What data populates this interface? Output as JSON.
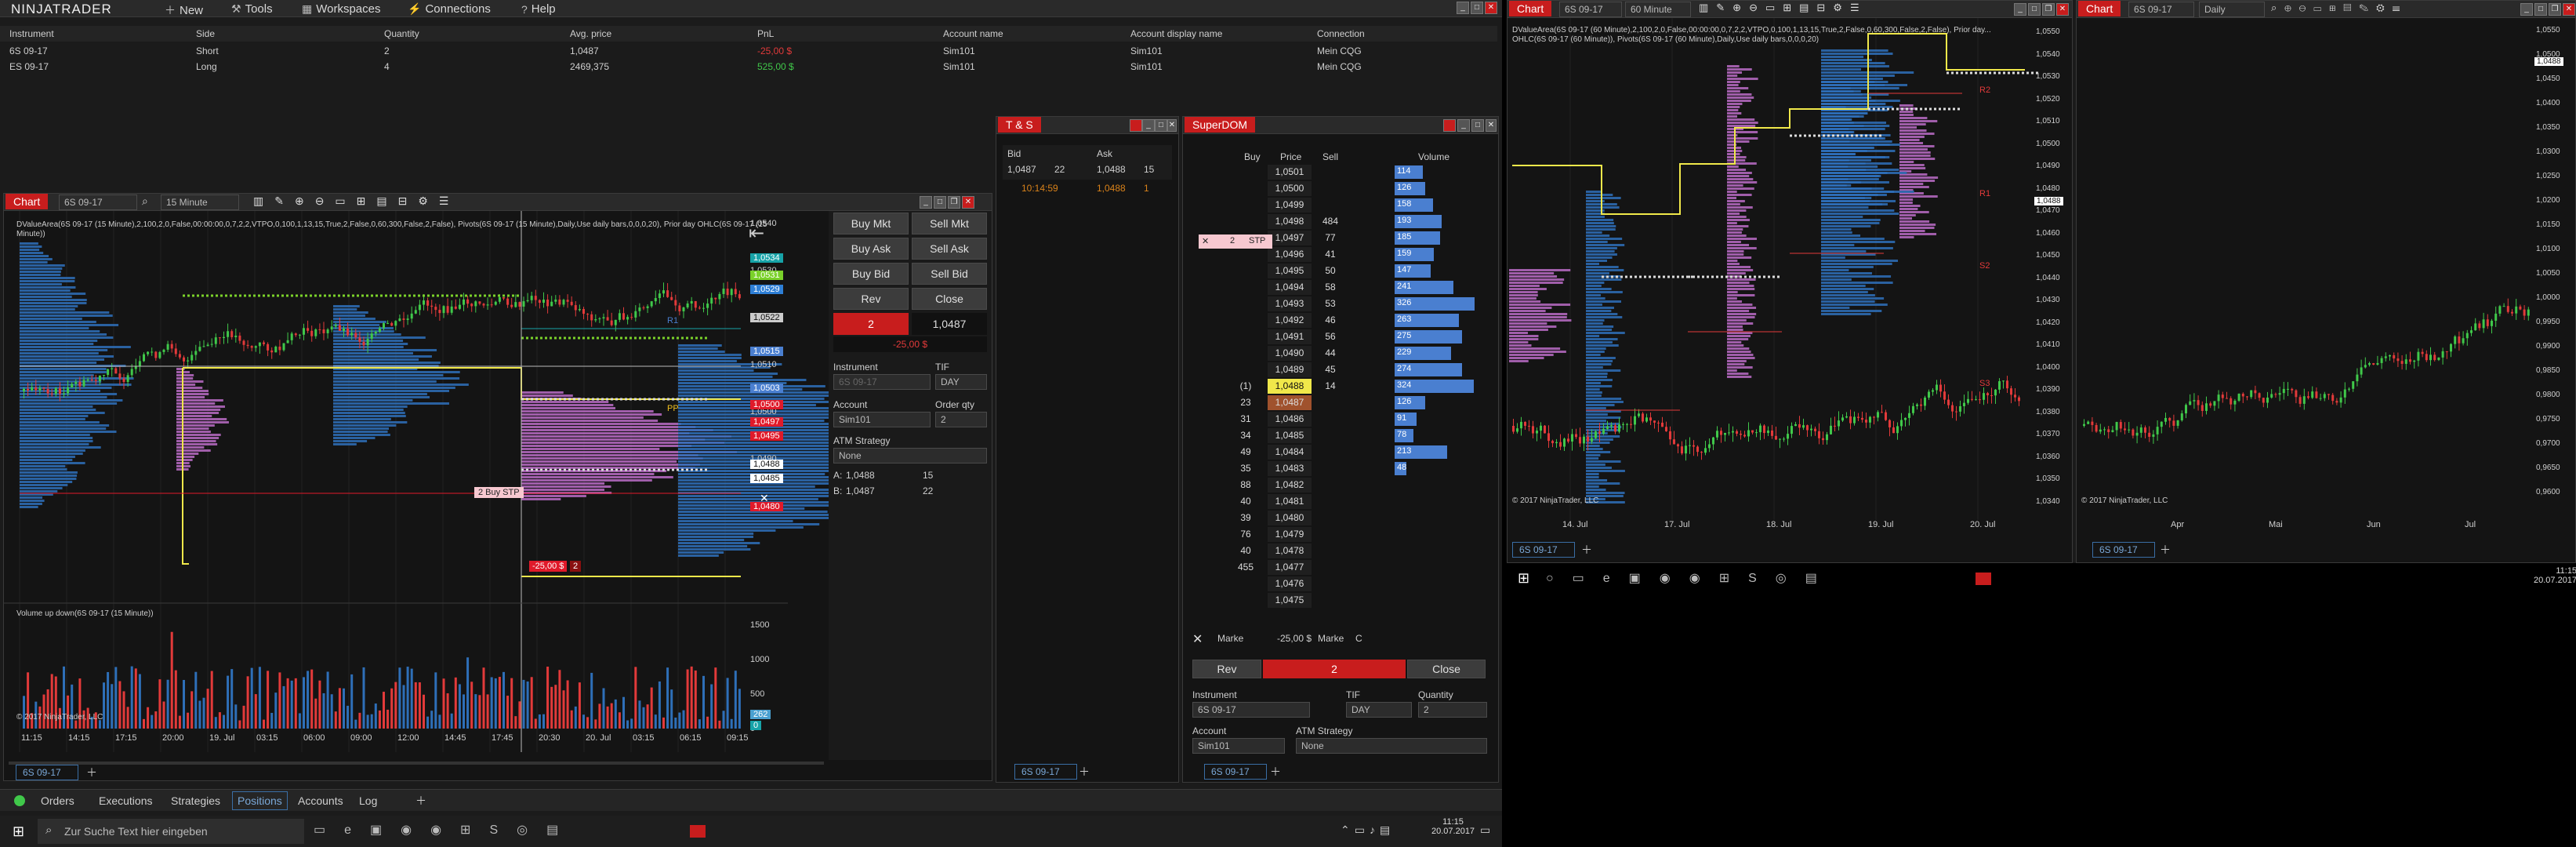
{
  "app": {
    "logo": "NINJATRADER"
  },
  "menu": [
    {
      "label": "New",
      "icon": "plus-icon"
    },
    {
      "label": "Tools",
      "icon": "wrench-icon"
    },
    {
      "label": "Workspaces",
      "icon": "grid-icon"
    },
    {
      "label": "Connections",
      "icon": "plug-icon"
    },
    {
      "label": "Help",
      "icon": "help-icon"
    }
  ],
  "positions": {
    "headers": [
      "Instrument",
      "Side",
      "Quantity",
      "Avg. price",
      "PnL",
      "Account name",
      "Account display name",
      "Connection"
    ],
    "rows": [
      {
        "instrument": "6S 09-17",
        "side": "Short",
        "qty": "2",
        "avg": "1,0487",
        "pnl": "-25,00 $",
        "pnl_color": "#e23a3a",
        "account": "Sim101",
        "display": "Sim101",
        "conn": "Mein CQG"
      },
      {
        "instrument": "ES 09-17",
        "side": "Long",
        "qty": "4",
        "avg": "2469,375",
        "pnl": "525,00 $",
        "pnl_color": "#40c84a",
        "account": "Sim101",
        "display": "Sim101",
        "conn": "Mein CQG"
      }
    ]
  },
  "chart1": {
    "tab": "Chart",
    "instrument": "6S 09-17",
    "interval": "15 Minute",
    "info": "DValueArea(6S 09-17 (15 Minute),2,100,2,0,False,00:00:00,0,7,2,2,VTPO,0,100,1,13,15,True,2,False,0,60,300,False,2,False), Pivots(6S 09-17 (15 Minute),Daily,Use daily bars,0,0,0,20), Prior day OHLC(6S 09-17 (15 Minute))",
    "y_ticks": [
      "1,0540",
      "1,0530",
      "1,0520",
      "1,0510",
      "1,0500",
      "1,0490",
      "1,0480"
    ],
    "price_tags": [
      {
        "v": "1,0534",
        "c": "#17a3a8"
      },
      {
        "v": "1,0531",
        "c": "#7ad12a"
      },
      {
        "v": "1,0529",
        "c": "#2e7fd6"
      },
      {
        "v": "1,0522",
        "c": "#cccccc"
      },
      {
        "v": "1,0515",
        "c": "#4a7fd0"
      },
      {
        "v": "1,0503",
        "c": "#4a7fd0"
      },
      {
        "v": "1,0500",
        "c": "#e01a2a"
      },
      {
        "v": "1,0497",
        "c": "#e01a2a"
      },
      {
        "v": "1,0495",
        "c": "#e01a2a"
      },
      {
        "v": "1,0488",
        "c": "#ffffff"
      },
      {
        "v": "1,0485",
        "c": "#ffffff"
      },
      {
        "v": "1,0480",
        "c": "#e01a2a"
      }
    ],
    "x_ticks": [
      "11:15",
      "14:15",
      "17:15",
      "20:00",
      "19. Jul",
      "03:15",
      "06:00",
      "09:00",
      "12:00",
      "14:45",
      "17:45",
      "20:30",
      "20. Jul",
      "03:15",
      "06:15",
      "09:15"
    ],
    "order_label": "2 Buy STP",
    "pnl_label": "-25,00 $",
    "pnl_qty": "2",
    "r1": "R1",
    "pp": "PP",
    "vol_label": "Volume up down(6S 09-17 (15 Minute))",
    "vol_ticks": [
      "1500",
      "1000",
      "500",
      "0"
    ],
    "vol_tags": [
      {
        "v": "262",
        "c": "#4aa0d0"
      },
      {
        "v": "0",
        "c": "#17a3a8"
      }
    ],
    "copyright": "© 2017 NinjaTrader, LLC",
    "footer_tab": "6S 09-17"
  },
  "chart_trader": {
    "buy_mkt": "Buy Mkt",
    "sell_mkt": "Sell Mkt",
    "buy_ask": "Buy Ask",
    "sell_ask": "Sell Ask",
    "buy_bid": "Buy Bid",
    "sell_bid": "Sell Bid",
    "rev": "Rev",
    "close": "Close",
    "pos_qty": "2",
    "pos_price": "1,0487",
    "pos_pnl": "-25,00 $",
    "instrument_lbl": "Instrument",
    "tif_lbl": "TIF",
    "instrument": "6S 09-17",
    "tif": "DAY",
    "account_lbl": "Account",
    "qty_lbl": "Order qty",
    "account": "Sim101",
    "qty": "2",
    "atm_lbl": "ATM Strategy",
    "atm": "None",
    "a_lbl": "A:",
    "a_price": "1,0488",
    "a_size": "15",
    "b_lbl": "B:",
    "b_price": "1,0487",
    "b_size": "22"
  },
  "ts": {
    "title": "T & S",
    "bid_lbl": "Bid",
    "ask_lbl": "Ask",
    "bid": "1,0487",
    "bid_size": "22",
    "ask": "1,0488",
    "ask_size": "15",
    "time": "10:14:59",
    "trade_price": "1,0488",
    "trade_size": "1",
    "footer_tab": "6S 09-17"
  },
  "dom": {
    "title": "SuperDOM",
    "headers": [
      "Buy",
      "Price",
      "Sell",
      "Volume"
    ],
    "order": {
      "qty": "2",
      "type": "STP"
    },
    "rows": [
      {
        "buy": "",
        "price": "1,0501",
        "sell": "",
        "vol": 0
      },
      {
        "buy": "",
        "price": "1,0500",
        "sell": "",
        "vol": 0
      },
      {
        "buy": "",
        "price": "1,0499",
        "sell": "",
        "vol": 0
      },
      {
        "buy": "",
        "price": "1,0498",
        "sell": "484",
        "vol": 0
      },
      {
        "buy": "",
        "price": "1,0497",
        "sell": "77",
        "vol": 0
      },
      {
        "buy": "",
        "price": "1,0496",
        "sell": "41",
        "vol": 0
      },
      {
        "buy": "",
        "price": "1,0495",
        "sell": "50",
        "vol": 0
      },
      {
        "buy": "",
        "price": "1,0494",
        "sell": "58",
        "vol": 0
      },
      {
        "buy": "",
        "price": "1,0493",
        "sell": "53",
        "vol": 0
      },
      {
        "buy": "",
        "price": "1,0492",
        "sell": "46",
        "vol": 0
      },
      {
        "buy": "",
        "price": "1,0491",
        "sell": "56",
        "vol": 0
      },
      {
        "buy": "",
        "price": "1,0490",
        "sell": "44",
        "vol": 0
      },
      {
        "buy": "",
        "price": "1,0489",
        "sell": "45",
        "vol": 0
      },
      {
        "buy": "(1)",
        "price": "1,0488",
        "sell": "14",
        "vol": 0
      },
      {
        "buy": "23",
        "price": "1,0487",
        "sell": "",
        "vol": 0
      },
      {
        "buy": "31",
        "price": "1,0486",
        "sell": "",
        "vol": 0
      },
      {
        "buy": "34",
        "price": "1,0485",
        "sell": "",
        "vol": 0
      },
      {
        "buy": "49",
        "price": "1,0484",
        "sell": "",
        "vol": 0
      },
      {
        "buy": "35",
        "price": "1,0483",
        "sell": "",
        "vol": 0
      },
      {
        "buy": "88",
        "price": "1,0482",
        "sell": "",
        "vol": 0
      },
      {
        "buy": "40",
        "price": "1,0481",
        "sell": "",
        "vol": 0
      },
      {
        "buy": "39",
        "price": "1,0480",
        "sell": "",
        "vol": 0
      },
      {
        "buy": "76",
        "price": "1,0479",
        "sell": "",
        "vol": 0
      },
      {
        "buy": "40",
        "price": "1,0478",
        "sell": "",
        "vol": 0
      },
      {
        "buy": "455",
        "price": "1,0477",
        "sell": "",
        "vol": 0
      },
      {
        "buy": "",
        "price": "1,0476",
        "sell": "",
        "vol": 0
      },
      {
        "buy": "",
        "price": "1,0475",
        "sell": "",
        "vol": 0
      }
    ],
    "volumes": [
      "114",
      "126",
      "158",
      "193",
      "185",
      "159",
      "147",
      "241",
      "326",
      "263",
      "275",
      "229",
      "274",
      "324",
      "126",
      "91",
      "78",
      "213",
      "48"
    ],
    "market_lbl": "Marke",
    "pnl": "-25,00 $",
    "rev": "Rev",
    "pos_qty": "2",
    "close": "Close",
    "instrument_lbl": "Instrument",
    "tif_lbl": "TIF",
    "qty_lbl": "Quantity",
    "instrument": "6S 09-17",
    "tif": "DAY",
    "qty": "2",
    "account_lbl": "Account",
    "atm_lbl": "ATM Strategy",
    "account": "Sim101",
    "atm": "None",
    "footer_tab": "6S 09-17"
  },
  "bottom_tabs": [
    "Orders",
    "Executions",
    "Strategies",
    "Positions",
    "Accounts",
    "Log"
  ],
  "taskbar_left": {
    "search": "Zur Suche Text hier eingeben",
    "time": "11:15",
    "date": "20.07.2017"
  },
  "chart2": {
    "tab": "Chart",
    "instrument": "6S 09-17",
    "interval": "60 Minute",
    "info1": "DValueArea(6S 09-17 (60 Minute),2,100,2,0,False,00:00:00,0,7,2,2,VTPO,0,100,1,13,15,True,2,False,0,60,300,False,2,False), Prior day...",
    "info2": "OHLC(6S 09-17 (60 Minute)), Pivots(6S 09-17 (60 Minute),Daily,Use daily bars,0,0,0,20)",
    "y_ticks": [
      "1,0550",
      "1,0540",
      "1,0530",
      "1,0520",
      "1,0510",
      "1,0500",
      "1,0490",
      "1,0480",
      "1,0470",
      "1,0460",
      "1,0450",
      "1,0440",
      "1,0430",
      "1,0420",
      "1,0410",
      "1,0400",
      "1,0390",
      "1,0380",
      "1,0370",
      "1,0360",
      "1,0350",
      "1,0340"
    ],
    "x_ticks": [
      "14. Jul",
      "17. Jul",
      "18. Jul",
      "19. Jul",
      "20. Jul"
    ],
    "price_tag": "1,0488",
    "r2": "R2",
    "r1": "R1",
    "s2": "S2",
    "s3": "S3",
    "copyright": "© 2017 NinjaTrader, LLC",
    "footer_tab": "6S 09-17"
  },
  "chart3": {
    "tab": "Chart",
    "instrument": "6S 09-17",
    "interval": "Daily",
    "y_ticks": [
      "1,0550",
      "1,0500",
      "1,0450",
      "1,0400",
      "1,0350",
      "1,0300",
      "1,0250",
      "1,0200",
      "1,0150",
      "1,0100",
      "1,0050",
      "1,0000",
      "0,9950",
      "0,9900",
      "0,9850",
      "0,9800",
      "0,9750",
      "0,9700",
      "0,9650",
      "0,9600"
    ],
    "x_ticks": [
      "Apr",
      "Mai",
      "Jun",
      "Jul"
    ],
    "price_tag": "1,0488",
    "copyright": "© 2017 NinjaTrader, LLC",
    "footer_tab": "6S 09-17"
  },
  "taskbar_right": {
    "time": "11:15",
    "date": "20.07.2017"
  },
  "colors": {
    "green": "#40c84a",
    "red": "#e23a3a",
    "blue": "#2e6fb8",
    "magenta": "#b96bc4",
    "yellow": "#f0e84a",
    "dom_blue": "#4a7fd0",
    "accent_red": "#c81d1d"
  }
}
